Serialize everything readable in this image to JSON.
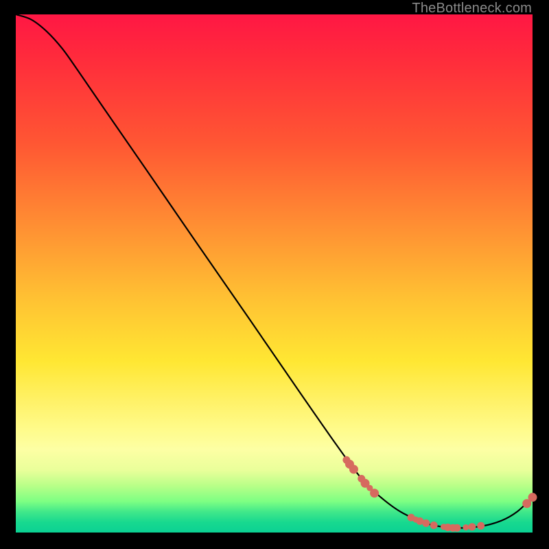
{
  "watermark": "TheBottleneck.com",
  "colors": {
    "curve_stroke": "#000000",
    "point_fill": "#d66a5f",
    "point_stroke": "#d66a5f"
  },
  "chart_data": {
    "type": "line",
    "title": "",
    "xlabel": "",
    "ylabel": "",
    "xlim": [
      0,
      100
    ],
    "ylim": [
      0,
      100
    ],
    "curve": [
      {
        "x": 0.0,
        "y": 100.0
      },
      {
        "x": 3.0,
        "y": 99.0
      },
      {
        "x": 6.0,
        "y": 96.7
      },
      {
        "x": 9.0,
        "y": 93.4
      },
      {
        "x": 12.0,
        "y": 89.2
      },
      {
        "x": 18.0,
        "y": 80.5
      },
      {
        "x": 25.0,
        "y": 70.4
      },
      {
        "x": 35.0,
        "y": 55.9
      },
      {
        "x": 45.0,
        "y": 41.5
      },
      {
        "x": 55.0,
        "y": 27.0
      },
      {
        "x": 62.0,
        "y": 17.0
      },
      {
        "x": 67.0,
        "y": 10.3
      },
      {
        "x": 71.0,
        "y": 6.5
      },
      {
        "x": 75.0,
        "y": 3.7
      },
      {
        "x": 80.0,
        "y": 1.6
      },
      {
        "x": 85.0,
        "y": 0.9
      },
      {
        "x": 90.0,
        "y": 1.2
      },
      {
        "x": 94.0,
        "y": 2.3
      },
      {
        "x": 97.0,
        "y": 4.0
      },
      {
        "x": 100.0,
        "y": 6.8
      }
    ],
    "points": [
      {
        "x": 64.0,
        "y": 14.0,
        "r": 5
      },
      {
        "x": 64.6,
        "y": 13.2,
        "r": 6
      },
      {
        "x": 65.4,
        "y": 12.2,
        "r": 6
      },
      {
        "x": 66.9,
        "y": 10.4,
        "r": 5
      },
      {
        "x": 67.6,
        "y": 9.5,
        "r": 6
      },
      {
        "x": 68.5,
        "y": 8.6,
        "r": 4
      },
      {
        "x": 69.4,
        "y": 7.6,
        "r": 6
      },
      {
        "x": 76.5,
        "y": 2.9,
        "r": 5
      },
      {
        "x": 77.4,
        "y": 2.5,
        "r": 4
      },
      {
        "x": 78.2,
        "y": 2.2,
        "r": 5
      },
      {
        "x": 79.4,
        "y": 1.8,
        "r": 5
      },
      {
        "x": 80.9,
        "y": 1.4,
        "r": 5
      },
      {
        "x": 82.8,
        "y": 1.1,
        "r": 4
      },
      {
        "x": 83.6,
        "y": 1.0,
        "r": 5
      },
      {
        "x": 84.6,
        "y": 0.9,
        "r": 5
      },
      {
        "x": 85.4,
        "y": 0.9,
        "r": 5
      },
      {
        "x": 87.1,
        "y": 1.0,
        "r": 4
      },
      {
        "x": 88.3,
        "y": 1.1,
        "r": 5
      },
      {
        "x": 90.0,
        "y": 1.3,
        "r": 5
      },
      {
        "x": 98.9,
        "y": 5.6,
        "r": 6
      },
      {
        "x": 100.0,
        "y": 6.8,
        "r": 6
      }
    ]
  }
}
